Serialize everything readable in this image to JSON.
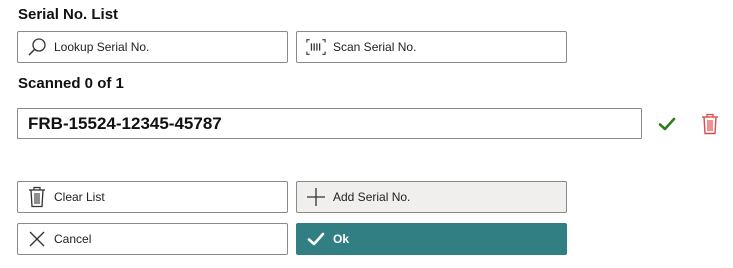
{
  "serial_list": {
    "title": "Serial No. List"
  },
  "toolbar": {
    "lookup_label": "Lookup Serial No.",
    "scan_label": "Scan Serial No."
  },
  "scan_status": {
    "text": "Scanned 0 of 1"
  },
  "entry": {
    "serial_value": "FRB-15524-12345-45787"
  },
  "actions": {
    "clear_label": "Clear List",
    "add_label": "Add Serial No.",
    "cancel_label": "Cancel",
    "ok_label": "Ok"
  },
  "icons": {
    "lookup": "search-icon",
    "scan": "barcode-icon",
    "confirm": "checkmark-icon",
    "delete": "trash-icon",
    "clear": "trash-icon",
    "add": "plus-icon",
    "cancel": "close-icon",
    "ok": "checkmark-icon"
  },
  "colors": {
    "primary": "#327f83",
    "confirm": "#2e7d1f",
    "delete": "#e04a4a",
    "secondary_button_bg": "#f0efee"
  }
}
